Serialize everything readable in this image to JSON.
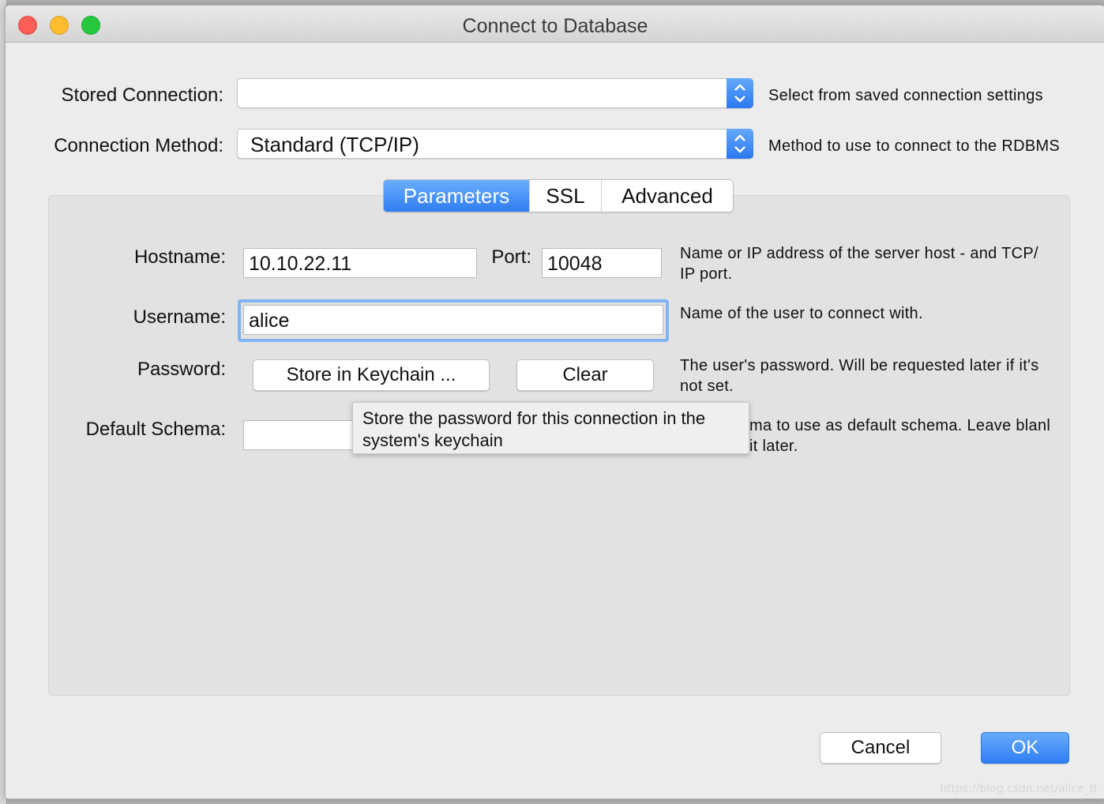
{
  "window": {
    "title": "Connect to Database"
  },
  "stored_connection": {
    "label": "Stored Connection:",
    "value": "",
    "hint": "Select from saved connection settings"
  },
  "connection_method": {
    "label": "Connection Method:",
    "value": "Standard (TCP/IP)",
    "hint": "Method to use to connect to the RDBMS"
  },
  "tabs": [
    "Parameters",
    "SSL",
    "Advanced"
  ],
  "active_tab": "Parameters",
  "parameters": {
    "hostname_label": "Hostname:",
    "hostname_value": "10.10.22.11",
    "port_label": "Port:",
    "port_value": "10048",
    "hostname_hint_line1": "Name or IP address of the server host - and TCP/",
    "hostname_hint_line2": "IP port.",
    "username_label": "Username:",
    "username_value": "alice",
    "username_hint": "Name of the user to connect with.",
    "password_label": "Password:",
    "store_keychain_button": "Store in Keychain ...",
    "clear_button": "Clear",
    "password_hint_line1": "The user's password. Will be requested later if it's",
    "password_hint_line2": "not set.",
    "schema_label": "Default Schema:",
    "schema_value": "",
    "schema_hint_line1": "ma to use as default schema. Leave blanl",
    "schema_hint_line2": "it later."
  },
  "tooltip": {
    "line1": "Store the password for this connection in the",
    "line2": "system's keychain"
  },
  "footer": {
    "cancel_button": "Cancel",
    "ok_button": "OK"
  },
  "watermark": "https://blog.csdn.net/alice_tl",
  "colors": {
    "accent": "#2f7df2",
    "focus_ring": "#80b4f2",
    "close": "#fc5f57",
    "minimize": "#fdbc2e",
    "maximize": "#27c840"
  }
}
